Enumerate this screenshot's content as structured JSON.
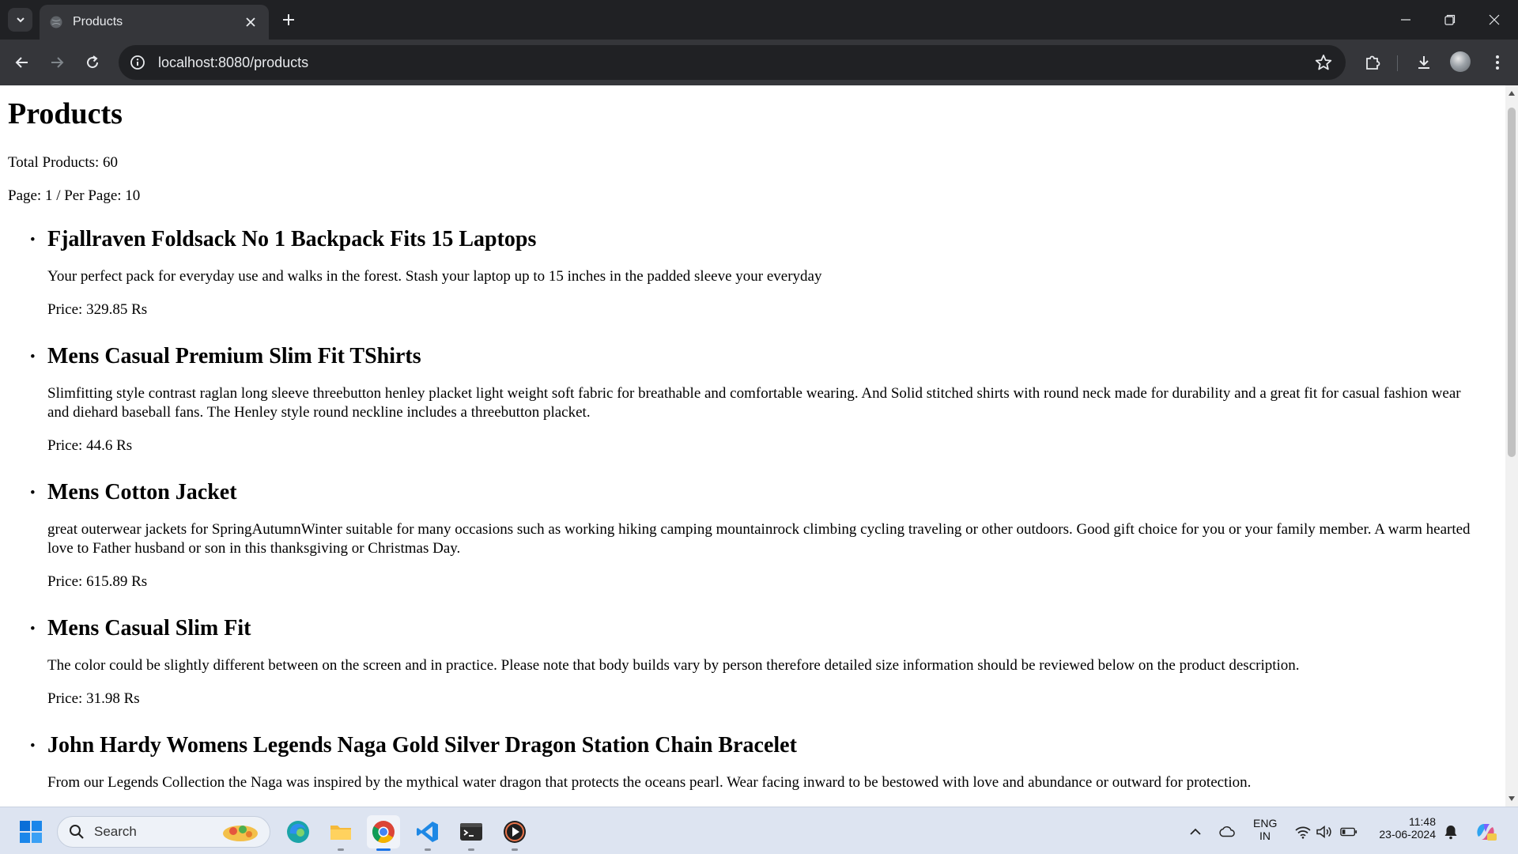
{
  "browser": {
    "tab_title": "Products",
    "url": "localhost:8080/products"
  },
  "page": {
    "title": "Products",
    "total_label": "Total Products: 60",
    "pagination_label": "Page: 1 / Per Page: 10",
    "products": [
      {
        "name": "Fjallraven Foldsack No 1 Backpack Fits 15 Laptops",
        "description": "Your perfect pack for everyday use and walks in the forest. Stash your laptop up to 15 inches in the padded sleeve your everyday",
        "price": "Price: 329.85 Rs"
      },
      {
        "name": "Mens Casual Premium Slim Fit TShirts",
        "description": "Slimfitting style contrast raglan long sleeve threebutton henley placket light weight soft fabric for breathable and comfortable wearing. And Solid stitched shirts with round neck made for durability and a great fit for casual fashion wear and diehard baseball fans. The Henley style round neckline includes a threebutton placket.",
        "price": "Price: 44.6 Rs"
      },
      {
        "name": "Mens Cotton Jacket",
        "description": "great outerwear jackets for SpringAutumnWinter suitable for many occasions such as working hiking camping mountainrock climbing cycling traveling or other outdoors. Good gift choice for you or your family member. A warm hearted love to Father husband or son in this thanksgiving or Christmas Day.",
        "price": "Price: 615.89 Rs"
      },
      {
        "name": "Mens Casual Slim Fit",
        "description": "The color could be slightly different between on the screen and in practice. Please note that body builds vary by person therefore detailed size information should be reviewed below on the product description.",
        "price": "Price: 31.98 Rs"
      },
      {
        "name": "John Hardy Womens Legends Naga Gold Silver Dragon Station Chain Bracelet",
        "description": "From our Legends Collection the Naga was inspired by the mythical water dragon that protects the oceans pearl. Wear facing inward to be bestowed with love and abundance or outward for protection.",
        "price": ""
      }
    ]
  },
  "taskbar": {
    "search_placeholder": "Search",
    "language_line1": "ENG",
    "language_line2": "IN",
    "time": "11:48",
    "date": "23-06-2024"
  },
  "colors": {
    "chrome_dark": "#202124",
    "chrome_toolbar": "#35363a",
    "page_bg": "#ffffff",
    "taskbar_bg": "#dde4f1",
    "accent_blue": "#1a73e8"
  }
}
